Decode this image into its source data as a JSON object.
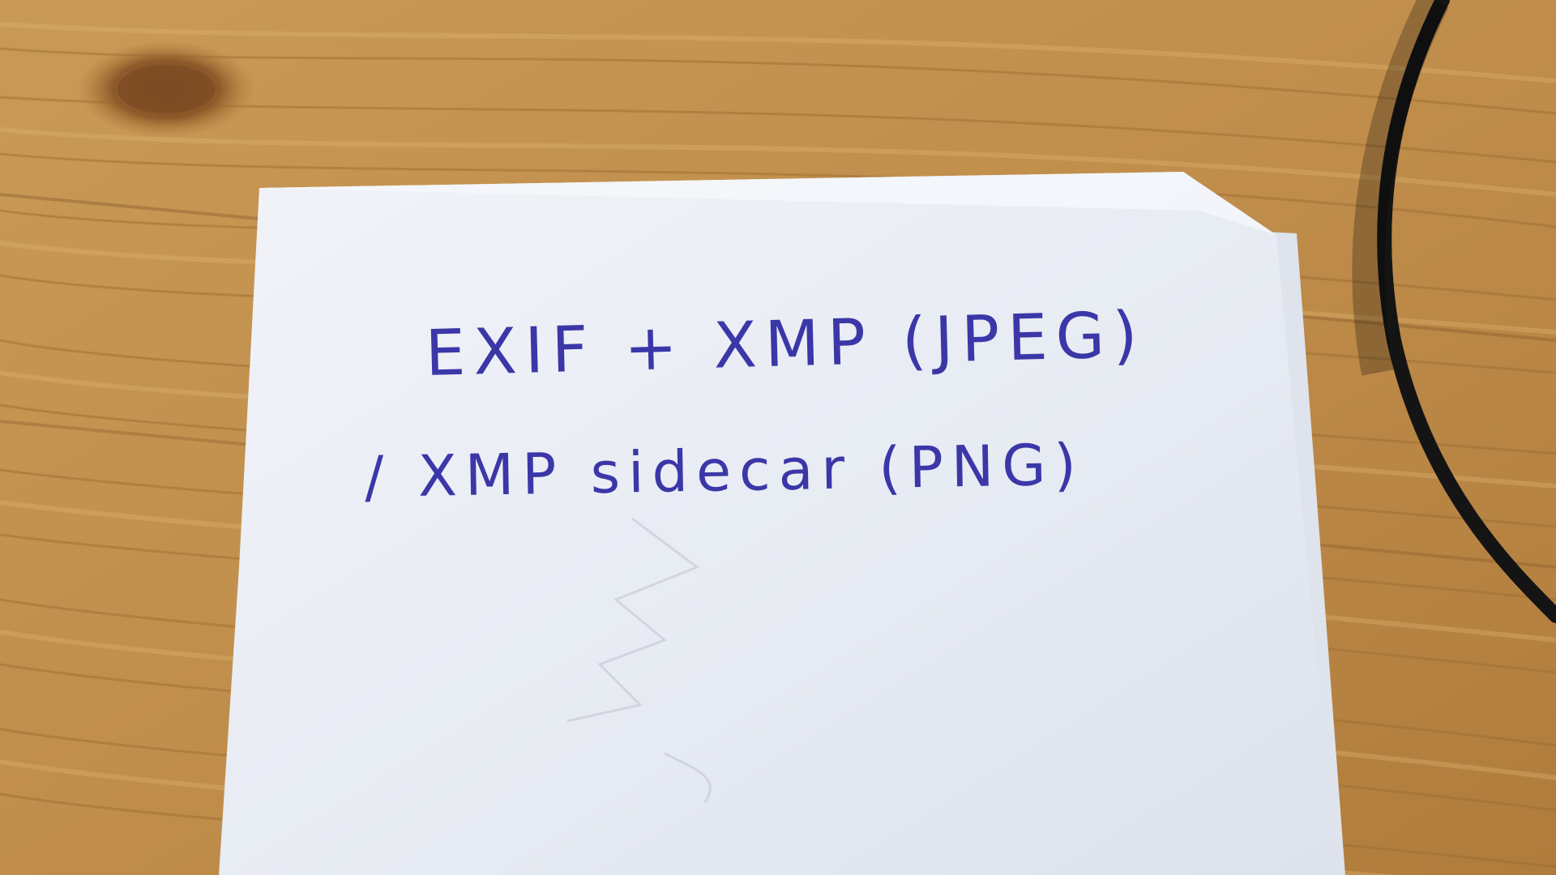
{
  "note": {
    "line_1": "EXIF + XMP (JPEG)",
    "line_2": "/ XMP sidecar (PNG)"
  },
  "colors": {
    "table_wood": "#c4924f",
    "wood_grain_dark": "#9a6a30",
    "paper": "#e8ecf3",
    "ink": "#3b37a8",
    "cable": "#141414"
  },
  "objects": [
    "wooden-table",
    "paper-sheet",
    "black-cable",
    "wood-knot"
  ]
}
